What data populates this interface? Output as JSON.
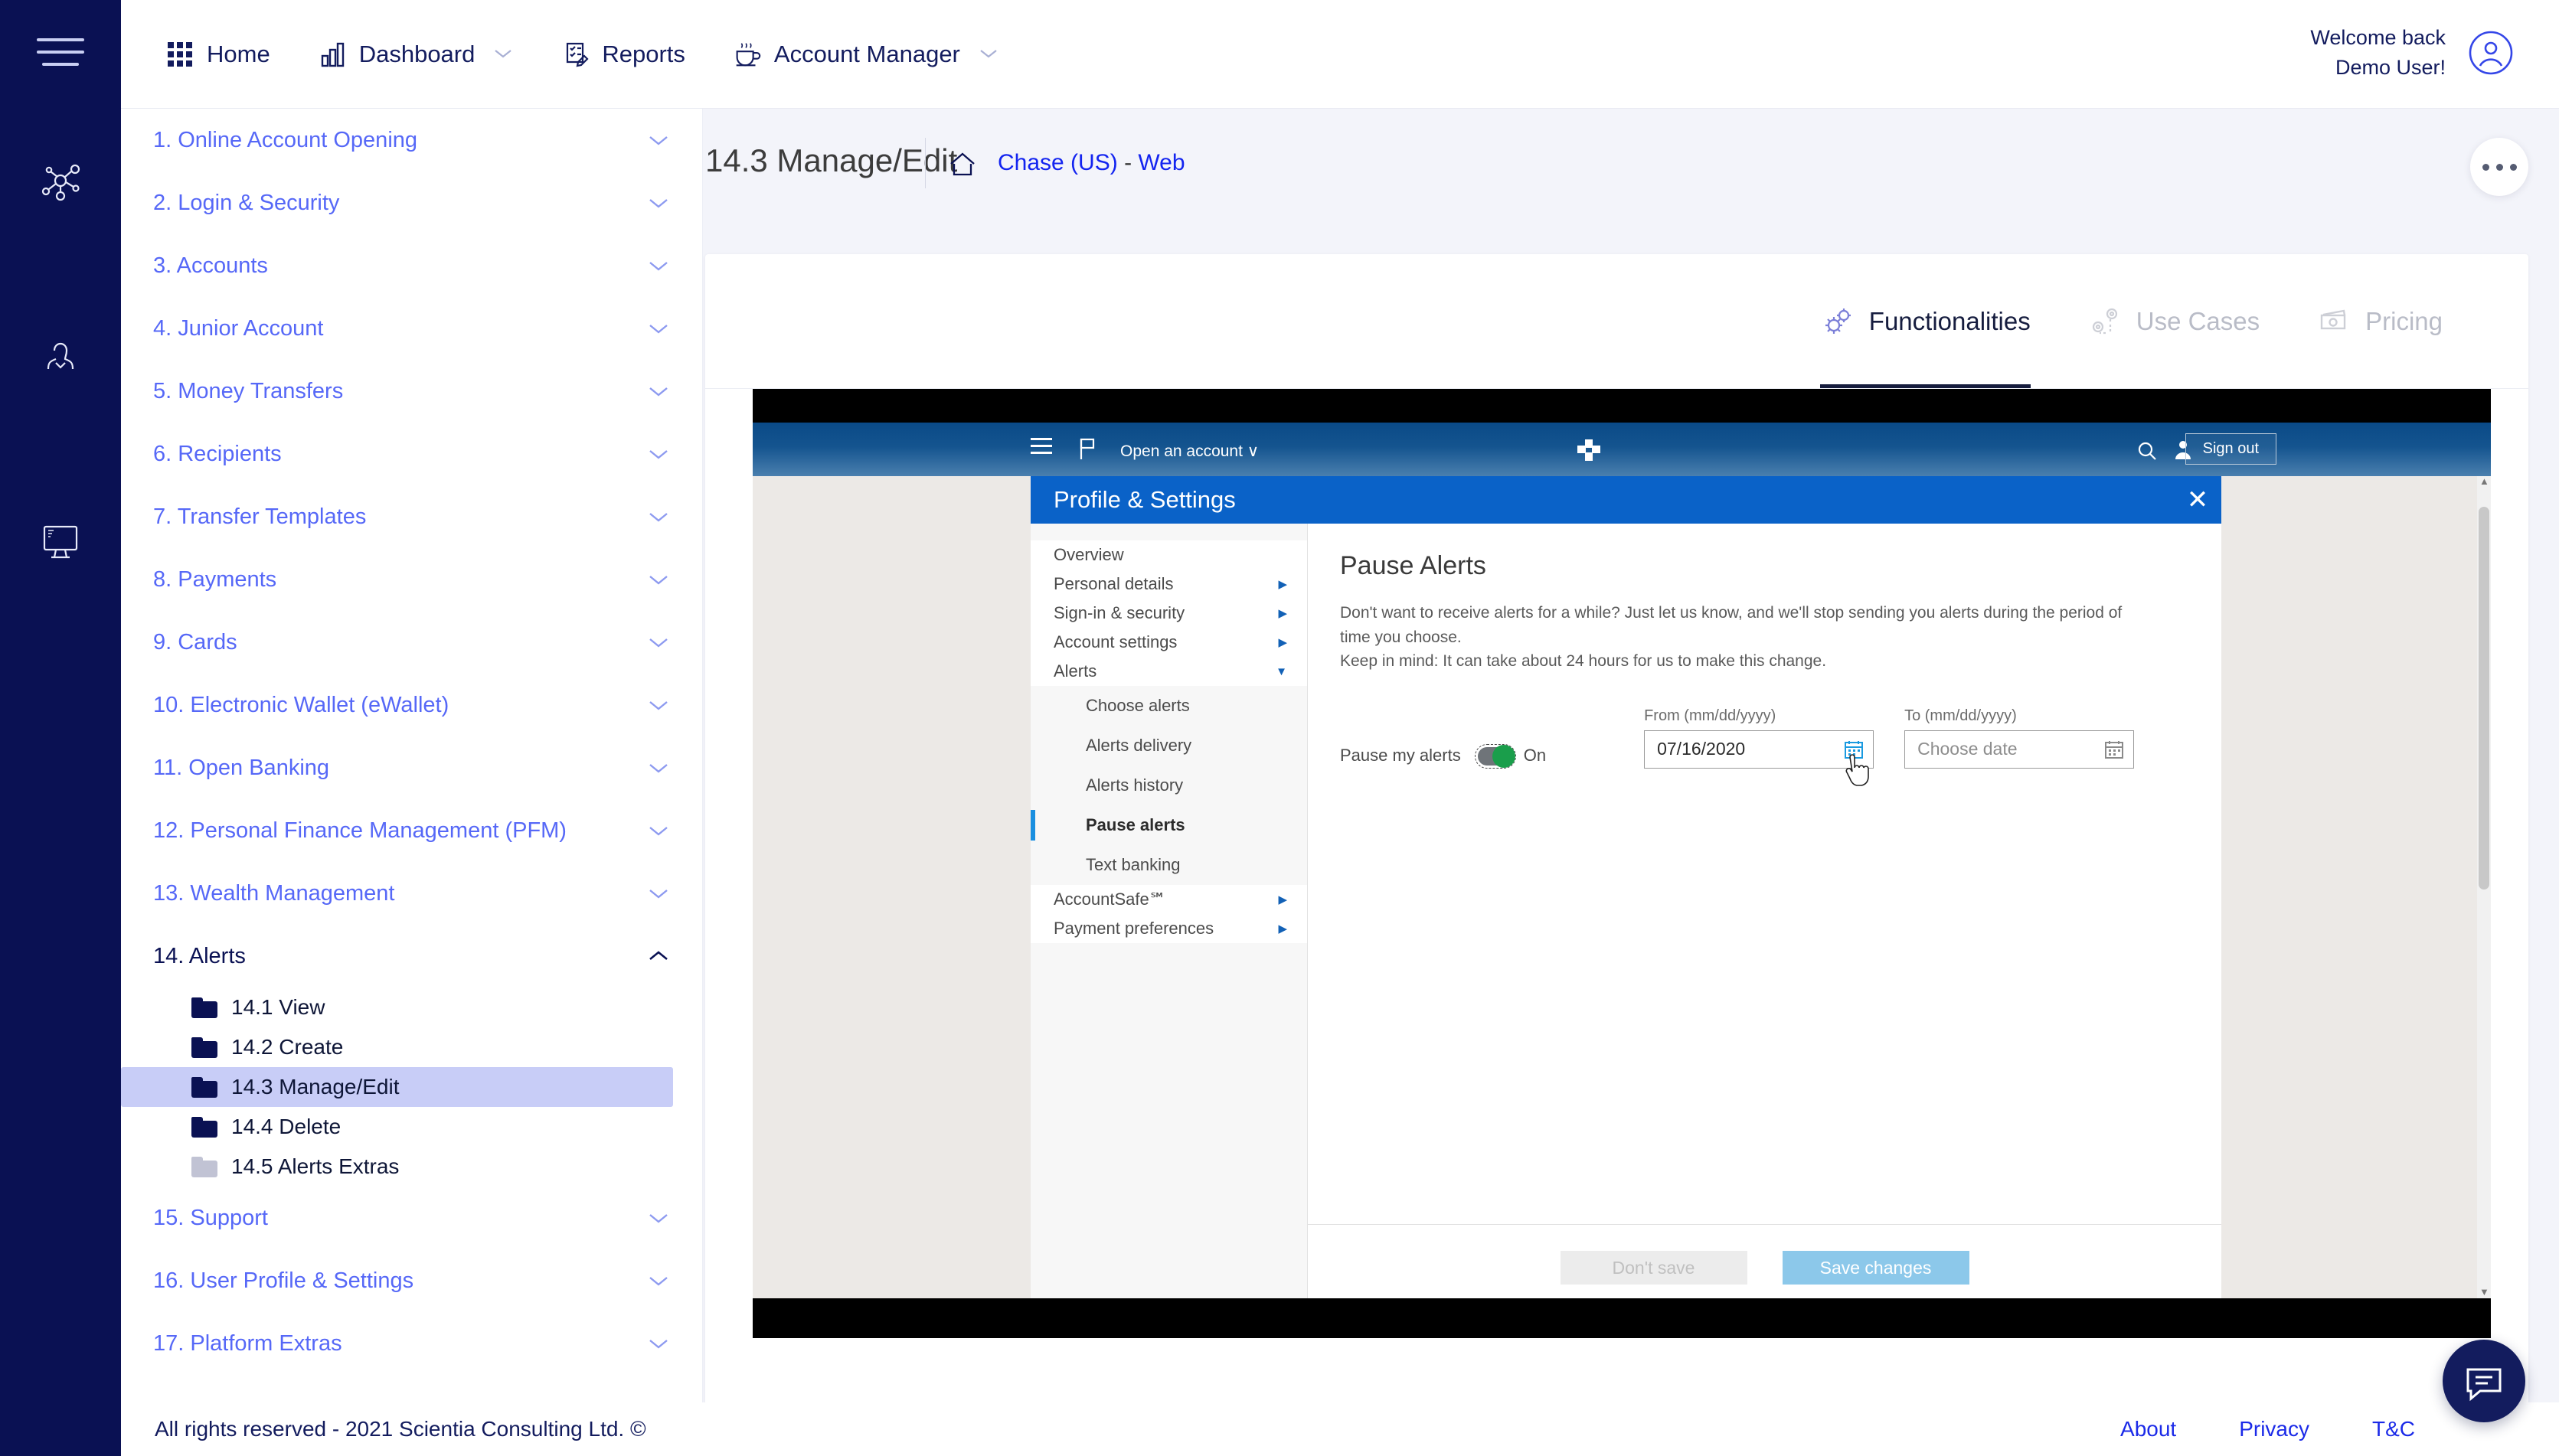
{
  "brand": {
    "navy": "#0a1153",
    "accent_blue": "#5668f7",
    "link_blue": "#1b2ae8",
    "highlight": "#c8cdf7"
  },
  "rail": {
    "menu_icon": "hamburger-menu-icon",
    "icons": [
      "network-hub-icon",
      "person-outline-icon",
      "monitor-screen-icon"
    ]
  },
  "topnav": {
    "items": [
      {
        "label": "Home",
        "icon": "grid-apps-icon",
        "caret": false
      },
      {
        "label": "Dashboard",
        "icon": "bar-chart-icon",
        "caret": true
      },
      {
        "label": "Reports",
        "icon": "clipboard-edit-icon",
        "caret": false
      },
      {
        "label": "Account Manager",
        "icon": "coffee-cup-icon",
        "caret": true
      }
    ],
    "welcome_line1": "Welcome back",
    "welcome_line2": "Demo User!",
    "avatar_icon": "user-circle-icon"
  },
  "sidebar": {
    "items": [
      {
        "label": "1. Online Account Opening",
        "expanded": false
      },
      {
        "label": "2. Login & Security",
        "expanded": false
      },
      {
        "label": "3. Accounts",
        "expanded": false
      },
      {
        "label": "4. Junior Account",
        "expanded": false
      },
      {
        "label": "5. Money Transfers",
        "expanded": false
      },
      {
        "label": "6. Recipients",
        "expanded": false
      },
      {
        "label": "7. Transfer Templates",
        "expanded": false
      },
      {
        "label": "8. Payments",
        "expanded": false
      },
      {
        "label": "9. Cards",
        "expanded": false
      },
      {
        "label": "10. Electronic Wallet (eWallet)",
        "expanded": false
      },
      {
        "label": "11. Open Banking",
        "expanded": false
      },
      {
        "label": "12. Personal Finance Management (PFM)",
        "expanded": false
      },
      {
        "label": "13. Wealth Management",
        "expanded": false
      },
      {
        "label": "14. Alerts",
        "expanded": true
      },
      {
        "label": "15. Support",
        "expanded": false
      },
      {
        "label": "16. User Profile & Settings",
        "expanded": false
      },
      {
        "label": "17. Platform Extras",
        "expanded": false
      }
    ],
    "alerts_children": [
      {
        "label": "14.1 View",
        "selected": false,
        "dim": false
      },
      {
        "label": "14.2 Create",
        "selected": false,
        "dim": false
      },
      {
        "label": "14.3 Manage/Edit",
        "selected": true,
        "dim": false
      },
      {
        "label": "14.4 Delete",
        "selected": false,
        "dim": false
      },
      {
        "label": "14.5 Alerts Extras",
        "selected": false,
        "dim": true
      }
    ]
  },
  "page": {
    "title": "14.3 Manage/Edit",
    "home_icon": "home-icon",
    "breadcrumb_bank": "Chase (US)",
    "breadcrumb_sep": "-",
    "breadcrumb_channel": "Web",
    "more_button": "more-options-icon"
  },
  "tabs": [
    {
      "label": "Functionalities",
      "icon": "gears-icon",
      "active": true
    },
    {
      "label": "Use Cases",
      "icon": "map-pin-path-icon",
      "active": false
    },
    {
      "label": "Pricing",
      "icon": "banknote-icon",
      "active": false
    }
  ],
  "mock": {
    "header": {
      "menu_icon": "hamburger-menu-icon",
      "flag_icon": "flag-icon",
      "open_account": "Open an account",
      "open_account_caret": "∨",
      "logo_icon": "chase-octagon-logo",
      "search_icon": "search-icon",
      "profile_icon": "person-icon",
      "sign_out": "Sign out"
    },
    "modal": {
      "title": "Profile & Settings",
      "close_icon": "close-x-icon",
      "menu": [
        {
          "label": "Overview",
          "arrow": false,
          "level": 0
        },
        {
          "label": "Personal details",
          "arrow": true,
          "level": 0
        },
        {
          "label": "Sign-in & security",
          "arrow": true,
          "level": 0
        },
        {
          "label": "Account settings",
          "arrow": true,
          "level": 0
        },
        {
          "label": "Alerts",
          "arrow": true,
          "expanded": true,
          "level": 0
        }
      ],
      "alerts_submenu": [
        {
          "label": "Choose alerts",
          "active": false
        },
        {
          "label": "Alerts delivery",
          "active": false
        },
        {
          "label": "Alerts history",
          "active": false
        },
        {
          "label": "Pause alerts",
          "active": true
        },
        {
          "label": "Text banking",
          "active": false
        }
      ],
      "menu_tail": [
        {
          "label": "AccountSafe℠",
          "arrow": true
        },
        {
          "label": "Payment preferences",
          "arrow": true
        }
      ],
      "pane": {
        "heading": "Pause Alerts",
        "description_line1": "Don't want to receive alerts for a while? Just let us know, and we'll stop sending you alerts during the period of time you choose.",
        "description_line2": "Keep in mind: It can take about 24 hours for us to make this change.",
        "toggle_label": "Pause my alerts",
        "toggle_state": "On",
        "from_label": "From (mm/dd/yyyy)",
        "from_value": "07/16/2020",
        "from_calendar_icon": "calendar-icon",
        "to_label": "To (mm/dd/yyyy)",
        "to_placeholder": "Choose date",
        "to_calendar_icon": "calendar-icon",
        "dont_save": "Don't save",
        "save_changes": "Save changes"
      }
    }
  },
  "footer": {
    "copyright": "All rights reserved - 2021 Scientia Consulting Ltd. ©",
    "links": [
      "About",
      "Privacy",
      "T&C"
    ],
    "chat_icon": "chat-bubble-icon"
  }
}
